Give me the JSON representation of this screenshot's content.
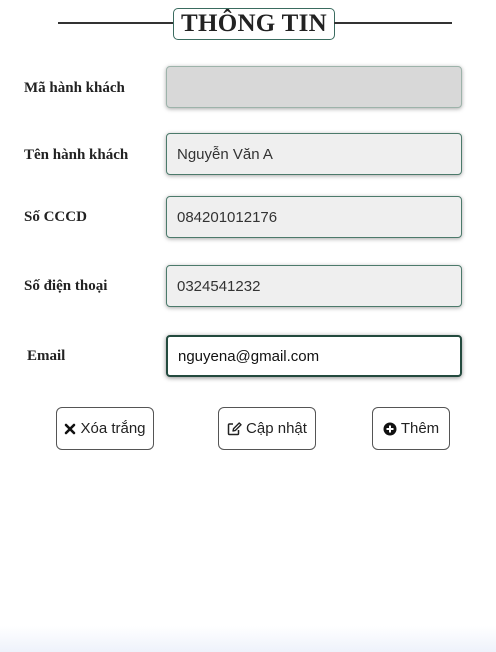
{
  "form": {
    "title": "THÔNG TIN",
    "fields": [
      {
        "label": "Mã hành khách",
        "value": "",
        "disabled": true
      },
      {
        "label": "Tên hành khách",
        "value": "Nguyễn Văn A"
      },
      {
        "label": "Số CCCD",
        "value": "084201012176"
      },
      {
        "label": "Số điện thoại",
        "value": "0324541232"
      },
      {
        "label": "Email",
        "value": "nguyena@gmail.com",
        "focused": true
      }
    ],
    "buttons": {
      "clear_label": "Xóa trắng",
      "update_label": "Cập nhật",
      "add_label": "Thêm"
    }
  },
  "icons": {
    "clear": "times-icon",
    "update": "edit-icon",
    "add": "plus-circle-icon"
  }
}
